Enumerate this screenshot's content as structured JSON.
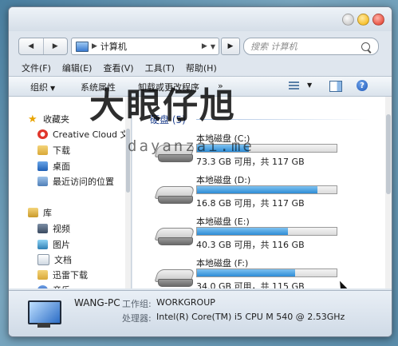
{
  "address": {
    "breadcrumb": "计算机",
    "search_placeholder": "搜索 计算机"
  },
  "menu": [
    "文件(F)",
    "编辑(E)",
    "查看(V)",
    "工具(T)",
    "帮助(H)"
  ],
  "toolbar": {
    "organize": "组织",
    "system_props": "系统属性",
    "uninstall": "卸载或更改程序",
    "more": "»"
  },
  "nav": {
    "favorites_label": "收藏夹",
    "favorites": [
      "Creative Cloud 文",
      "下载",
      "桌面",
      "最近访问的位置"
    ],
    "library_label": "库",
    "libraries": [
      "视频",
      "图片",
      "文档",
      "迅雷下载",
      "音乐"
    ]
  },
  "content": {
    "group_title": "硬盘 (5)",
    "drives": [
      {
        "name": "本地磁盘 (C:)",
        "info": "73.3 GB 可用，共 117 GB",
        "used_fraction": 0.37
      },
      {
        "name": "本地磁盘 (D:)",
        "info": "16.8 GB 可用，共 117 GB",
        "used_fraction": 0.86
      },
      {
        "name": "本地磁盘 (E:)",
        "info": "40.3 GB 可用，共 116 GB",
        "used_fraction": 0.65
      },
      {
        "name": "本地磁盘 (F:)",
        "info": "34.0 GB 可用，共 115 GB",
        "used_fraction": 0.7
      }
    ]
  },
  "details": {
    "pc_name": "WANG-PC",
    "workgroup_label": "工作组:",
    "workgroup": "WORKGROUP",
    "cpu_label": "处理器:",
    "cpu": "Intel(R) Core(TM) i5 CPU      M 540  @ 2.53GHz"
  },
  "watermark": {
    "logo": "大眼仔旭",
    "url": "dayanzai.me"
  },
  "colors": {
    "bar_fill": "#2e8cd6",
    "group_title": "#1e3f8c",
    "toolbar_bg": "#dae3ec"
  }
}
